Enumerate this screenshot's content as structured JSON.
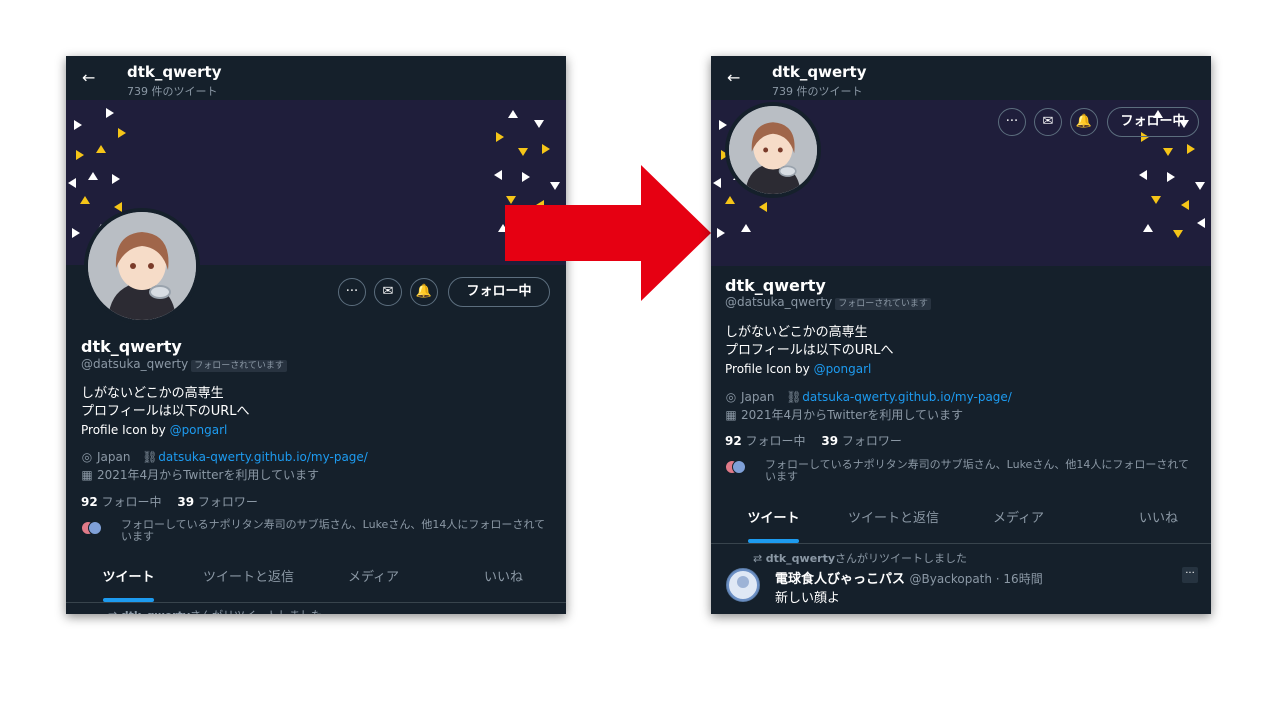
{
  "profile": {
    "name": "dtk_qwerty",
    "tweet_count": "739 件のツイート",
    "handle": "@datsuka_qwerty",
    "follows_you": "フォローされています",
    "bio_line1": "しがないどこかの高専生",
    "bio_line2": "プロフィールは以下のURLへ",
    "bio_line3_prefix": "Profile Icon by ",
    "bio_line3_link": "@pongarl",
    "location": "Japan",
    "url": "datsuka-qwerty.github.io/my-page/",
    "joined": "2021年4月からTwitterを利用しています",
    "following_count": "92",
    "following_label": "フォロー中",
    "followers_count": "39",
    "followers_label": "フォロワー",
    "followed_by": "フォローしているナポリタン寿司のサブ垢さん、Lukeさん、他14人にフォローされています"
  },
  "buttons": {
    "follow": "フォロー中",
    "more": "···",
    "message": "✉",
    "notify": "🔔"
  },
  "icons": {
    "back": "←",
    "location": "◎",
    "link": "🔗",
    "calendar": "▦",
    "retweet": "⇄"
  },
  "tabs": [
    "ツイート",
    "ツイートと返信",
    "メディア",
    "いいね"
  ],
  "tweet": {
    "retweeted_by_name": "dtk_qwerty",
    "retweeted_suffix": "さんがリツイートしました",
    "author": "電球食人びゃっこパス",
    "meta": "@Byackopath · 16時間",
    "text": "新しい顔よ"
  },
  "colors": {
    "background": "#15202b",
    "banner": "#1f1e3b",
    "accent": "#1d9bf0",
    "arrow": "#e60012",
    "triangle_yellow": "#f5c518",
    "triangle_white": "#ffffff"
  }
}
